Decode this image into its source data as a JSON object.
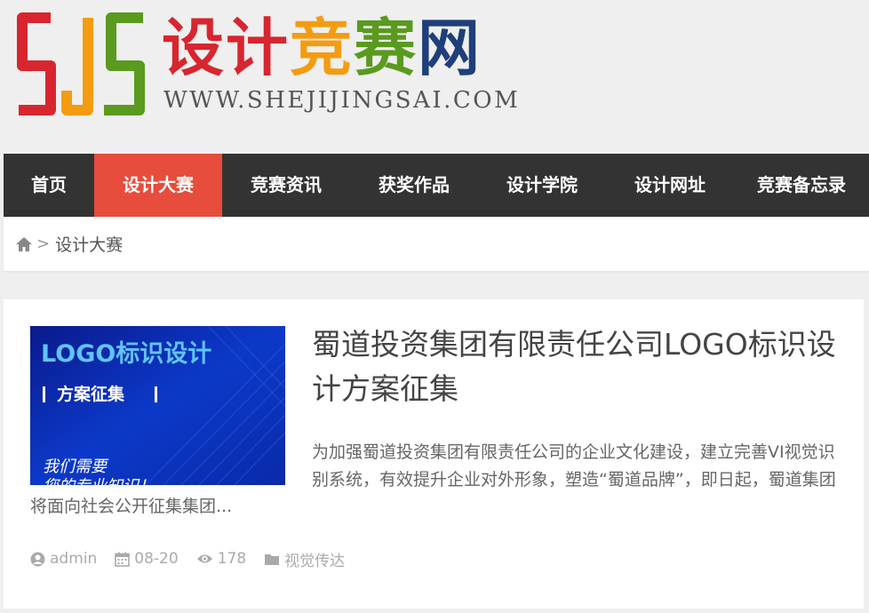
{
  "site": {
    "logo_cn_chars": [
      {
        "char": "设",
        "color": "#d7262f"
      },
      {
        "char": "计",
        "color": "#d7262f"
      },
      {
        "char": "竞",
        "color": "#f39c12"
      },
      {
        "char": "赛",
        "color": "#5a9a1e"
      },
      {
        "char": "网",
        "color": "#1f3f7a"
      }
    ],
    "logo_url": "WWW.SHEJIJINGSAI.COM"
  },
  "nav": [
    {
      "label": "首页",
      "active": false
    },
    {
      "label": "设计大赛",
      "active": true
    },
    {
      "label": "竞赛资讯",
      "active": false
    },
    {
      "label": "获奖作品",
      "active": false
    },
    {
      "label": "设计学院",
      "active": false
    },
    {
      "label": "设计网址",
      "active": false
    },
    {
      "label": "竞赛备忘录",
      "active": false
    }
  ],
  "breadcrumb": {
    "home_icon": "home-icon",
    "separator": ">",
    "current": "设计大赛"
  },
  "article": {
    "thumbnail": {
      "line1": "LOGO标识设计",
      "line2": "方案征集",
      "line3": "我们需要",
      "line4": "您的专业知识！"
    },
    "title": "蜀道投资集团有限责任公司LOGO标识设计方案征集",
    "excerpt": "为加强蜀道投资集团有限责任公司的企业文化建设，建立完善VI视觉识别系统，有效提升企业对外形象，塑造“蜀道品牌”，即日起，蜀道集团将面向社会公开征集集团...",
    "meta": {
      "author": "admin",
      "date": "08-20",
      "views": "178",
      "category": "视觉传达"
    }
  },
  "colors": {
    "nav_bg": "#333333",
    "nav_active": "#e74c3c",
    "page_bg": "#efefef"
  }
}
